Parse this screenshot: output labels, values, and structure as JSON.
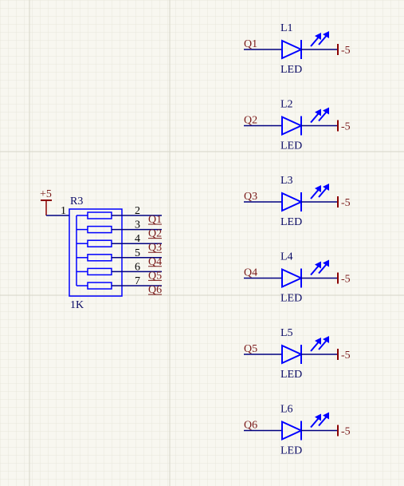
{
  "colors": {
    "background": "#f8f7f0",
    "grid": "#e5e4d9",
    "grid_major": "#d8d7cb",
    "component": "#0000ff",
    "wire": "#000080",
    "net_label": "#7a1a1a",
    "power": "#8b0000",
    "text": "#0a0a66"
  },
  "resistor_network": {
    "designator": "R3",
    "value": "1K",
    "common_pin": "1",
    "power_label": "+5",
    "rows": [
      {
        "pin": "2",
        "net": "Q1"
      },
      {
        "pin": "3",
        "net": "Q2"
      },
      {
        "pin": "4",
        "net": "Q3"
      },
      {
        "pin": "5",
        "net": "Q4"
      },
      {
        "pin": "6",
        "net": "Q5"
      },
      {
        "pin": "7",
        "net": "Q6"
      }
    ]
  },
  "leds": [
    {
      "designator": "L1",
      "value": "LED",
      "net": "Q1",
      "supply": "-5"
    },
    {
      "designator": "L2",
      "value": "LED",
      "net": "Q2",
      "supply": "-5"
    },
    {
      "designator": "L3",
      "value": "LED",
      "net": "Q3",
      "supply": "-5"
    },
    {
      "designator": "L4",
      "value": "LED",
      "net": "Q4",
      "supply": "-5"
    },
    {
      "designator": "L5",
      "value": "LED",
      "net": "Q5",
      "supply": "-5"
    },
    {
      "designator": "L6",
      "value": "LED",
      "net": "Q6",
      "supply": "-5"
    }
  ]
}
